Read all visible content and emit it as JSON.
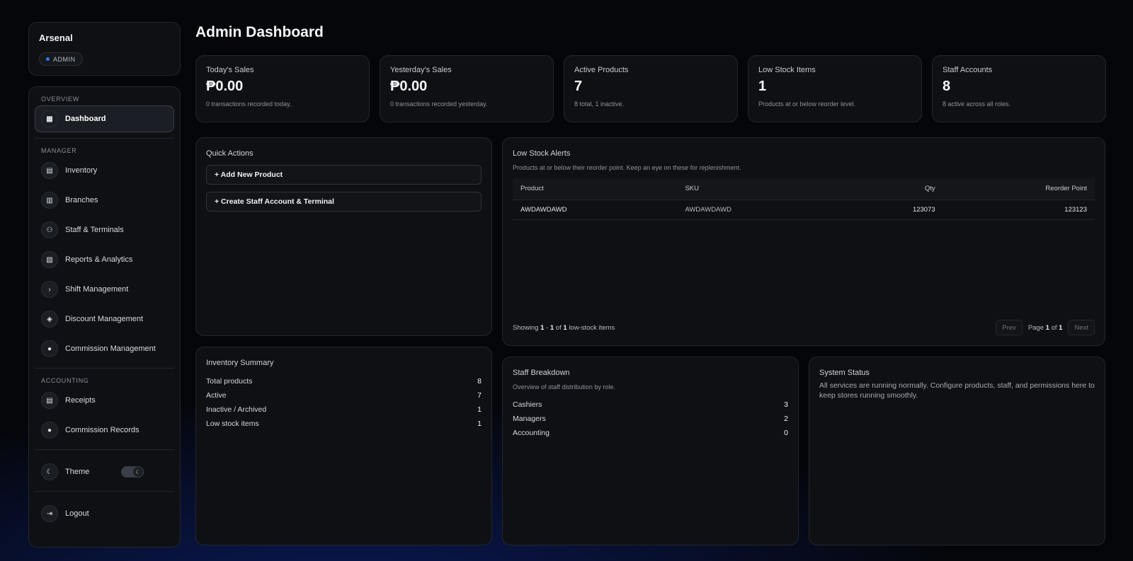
{
  "brand": {
    "name": "Arsenal",
    "role": "ADMIN"
  },
  "nav": {
    "sections": [
      {
        "title": "OVERVIEW",
        "items": [
          {
            "label": "Dashboard",
            "icon": "grid-icon"
          }
        ]
      },
      {
        "title": "MANAGER",
        "items": [
          {
            "label": "Inventory",
            "icon": "clipboard-icon"
          },
          {
            "label": "Branches",
            "icon": "building-icon"
          },
          {
            "label": "Staff & Terminals",
            "icon": "users-icon"
          },
          {
            "label": "Reports & Analytics",
            "icon": "report-icon"
          },
          {
            "label": "Shift Management",
            "icon": "terminal-icon"
          },
          {
            "label": "Discount Management",
            "icon": "tag-icon"
          },
          {
            "label": "Commission Management",
            "icon": "coin-icon"
          }
        ]
      },
      {
        "title": "ACCOUNTING",
        "items": [
          {
            "label": "Receipts",
            "icon": "receipt-icon"
          },
          {
            "label": "Commission Records",
            "icon": "coin-icon"
          }
        ]
      }
    ],
    "theme_label": "Theme",
    "logout_label": "Logout"
  },
  "page": {
    "title": "Admin Dashboard"
  },
  "stats": [
    {
      "label": "Today's Sales",
      "value": "₱0.00",
      "sub": "0 transactions recorded today."
    },
    {
      "label": "Yesterday's Sales",
      "value": "₱0.00",
      "sub": "0 transactions recorded yesterday."
    },
    {
      "label": "Active Products",
      "value": "7",
      "sub": "8 total, 1 inactive."
    },
    {
      "label": "Low Stock Items",
      "value": "1",
      "sub": "Products at or below reorder level."
    },
    {
      "label": "Staff Accounts",
      "value": "8",
      "sub": "8 active across all roles."
    }
  ],
  "quick_actions": {
    "title": "Quick Actions",
    "add_product": "+ Add New Product",
    "create_staff": "+ Create Staff Account & Terminal"
  },
  "low_stock": {
    "title": "Low Stock Alerts",
    "subtitle": "Products at or below their reorder point. Keep an eye on these for replenishment.",
    "columns": {
      "product": "Product",
      "sku": "SKU",
      "qty": "Qty",
      "reorder": "Reorder Point"
    },
    "rows": [
      {
        "product": "AWDAWDAWD",
        "sku": "AWDAWDAWD",
        "qty": "123073",
        "reorder": "123123"
      }
    ],
    "footer": {
      "showing": "Showing",
      "from": "1",
      "dash": "-",
      "to": "1",
      "of": "of",
      "total": "1",
      "suffix": "low-stock items"
    },
    "pager": {
      "prev": "Prev",
      "page_word": "Page",
      "page": "1",
      "of": "of",
      "pages": "1",
      "next": "Next"
    }
  },
  "inventory_summary": {
    "title": "Inventory Summary",
    "rows": [
      {
        "label": "Total products",
        "value": "8"
      },
      {
        "label": "Active",
        "value": "7"
      },
      {
        "label": "Inactive / Archived",
        "value": "1"
      },
      {
        "label": "Low stock items",
        "value": "1"
      }
    ]
  },
  "staff_breakdown": {
    "title": "Staff Breakdown",
    "subtitle": "Overview of staff distribution by role.",
    "rows": [
      {
        "label": "Cashiers",
        "value": "3"
      },
      {
        "label": "Managers",
        "value": "2"
      },
      {
        "label": "Accounting",
        "value": "0"
      }
    ]
  },
  "system_status": {
    "title": "System Status",
    "text": "All services are running normally. Configure products, staff, and permissions here to keep stores running smoothly."
  }
}
